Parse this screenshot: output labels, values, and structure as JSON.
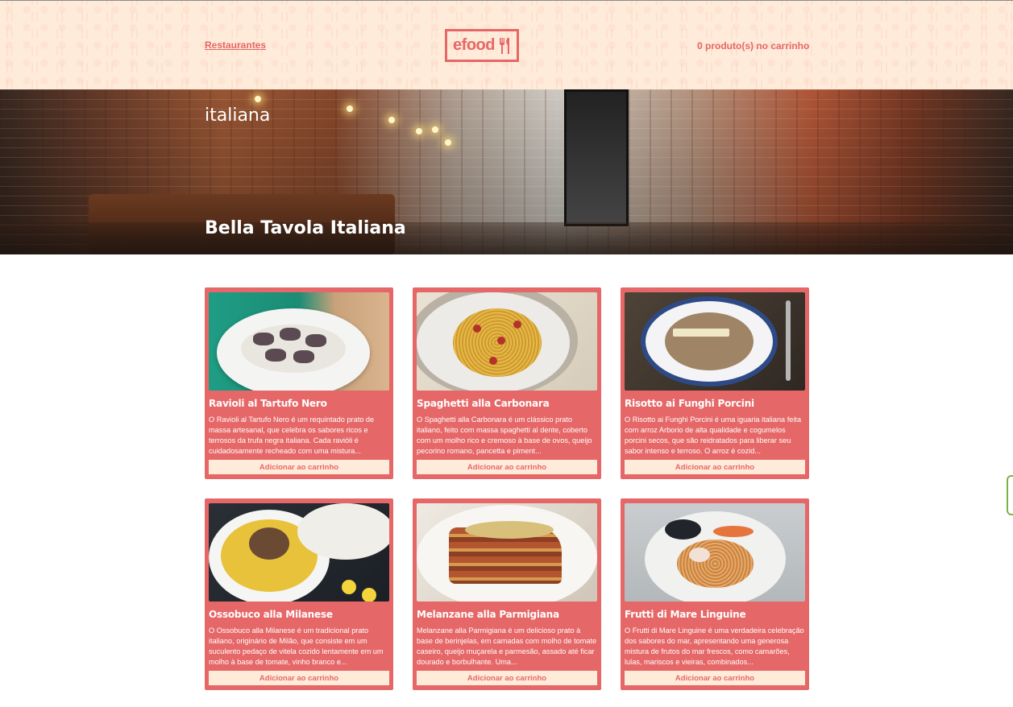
{
  "header": {
    "nav_link": "Restaurantes",
    "logo_text": "efood",
    "cart_text": "0 produto(s) no carrinho"
  },
  "banner": {
    "cuisine": "italiana",
    "restaurant_name": "Bella Tavola Italiana"
  },
  "products": [
    {
      "title": "Ravioli al Tartufo Nero",
      "description": "O Ravioli al Tartufo Nero é um requintado prato de massa artesanal, que celebra os sabores ricos e terrosos da trufa negra italiana. Cada ravióli é cuidadosamente recheado com uma mistura...",
      "button": "Adicionar ao carrinho",
      "image_icon": "ravioli-dish-image"
    },
    {
      "title": "Spaghetti alla Carbonara",
      "description": "O Spaghetti alla Carbonara é um clássico prato italiano, feito com massa spaghetti al dente, coberto com um molho rico e cremoso à base de ovos, queijo pecorino romano, pancetta e piment...",
      "button": "Adicionar ao carrinho",
      "image_icon": "spaghetti-dish-image"
    },
    {
      "title": "Risotto ai Funghi Porcini",
      "description": "O Risotto ai Funghi Porcini é uma iguaria italiana feita com arroz Arborio de alta qualidade e cogumelos porcini secos, que são reidratados para liberar seu sabor intenso e terroso. O arroz é cozid...",
      "button": "Adicionar ao carrinho",
      "image_icon": "risotto-dish-image"
    },
    {
      "title": "Ossobuco alla Milanese",
      "description": "O Ossobuco alla Milanese é um tradicional prato italiano, originário de Milão, que consiste em um suculento pedaço de vitela cozido lentamente em um molho à base de tomate, vinho branco e...",
      "button": "Adicionar ao carrinho",
      "image_icon": "ossobuco-dish-image"
    },
    {
      "title": "Melanzane alla Parmigiana",
      "description": "Melanzane alla Parmigiana é um delicioso prato à base de berinjelas, em camadas com molho de tomate caseiro, queijo muçarela e parmesão, assado até ficar dourado e borbulhante. Uma...",
      "button": "Adicionar ao carrinho",
      "image_icon": "parmigiana-dish-image"
    },
    {
      "title": "Frutti di Mare Linguine",
      "description": "O Frutti di Mare Linguine é uma verdadeira celebração dos sabores do mar, apresentando uma generosa mistura de frutos do mar frescos, como camarões, lulas, mariscos e vieiras, combinados...",
      "button": "Adicionar ao carrinho",
      "image_icon": "seafood-linguine-dish-image"
    }
  ],
  "colors": {
    "primary": "#e66767",
    "header_bg": "#ffebd9",
    "button_bg": "#ffebd9"
  }
}
